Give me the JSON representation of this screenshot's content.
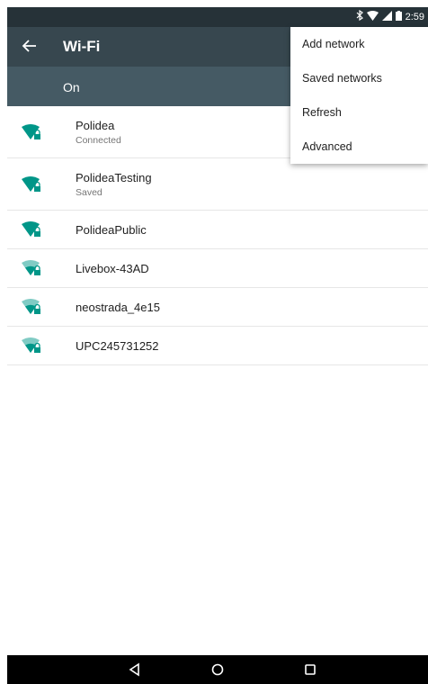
{
  "status_bar": {
    "time": "2:59",
    "icons": [
      "bluetooth-icon",
      "wifi-signal-icon",
      "cell-signal-icon",
      "battery-icon"
    ]
  },
  "app_bar": {
    "title": "Wi-Fi",
    "back_icon": "arrow-left-icon"
  },
  "wifi_toggle": {
    "label": "On"
  },
  "networks": [
    {
      "ssid": "Polidea",
      "status": "Connected",
      "signal_level": 4,
      "secured": true
    },
    {
      "ssid": "PolideaTesting",
      "status": "Saved",
      "signal_level": 4,
      "secured": true
    },
    {
      "ssid": "PolideaPublic",
      "status": "",
      "signal_level": 4,
      "secured": true
    },
    {
      "ssid": "Livebox-43AD",
      "status": "",
      "signal_level": 2,
      "secured": true
    },
    {
      "ssid": "neostrada_4e15",
      "status": "",
      "signal_level": 2,
      "secured": true
    },
    {
      "ssid": "UPC245731252",
      "status": "",
      "signal_level": 2,
      "secured": true
    }
  ],
  "overflow_menu": {
    "items": [
      "Add network",
      "Saved networks",
      "Refresh",
      "Advanced"
    ]
  },
  "nav_bar": {
    "buttons": [
      "back-triangle-icon",
      "home-circle-icon",
      "recents-square-icon"
    ]
  },
  "colors": {
    "status_bar": "#263238",
    "app_bar": "#37474f",
    "toggle_bar": "#455a64",
    "accent": "#009688",
    "accent_light": "#80cbc4"
  }
}
